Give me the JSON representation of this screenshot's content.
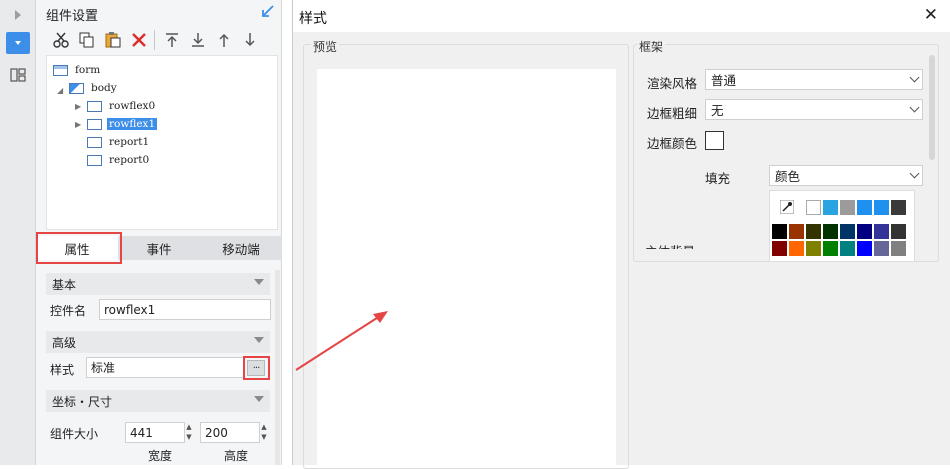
{
  "left_panel": {
    "title": "组件设置",
    "tree": {
      "root": "form",
      "body": "body",
      "items": [
        "rowflex0",
        "rowflex1",
        "report1",
        "report0"
      ]
    },
    "tabs": [
      "属性",
      "事件",
      "移动端"
    ],
    "sections": {
      "basic": "基本",
      "advanced": "高级",
      "position_size": "坐标・尺寸"
    },
    "props": {
      "control_name_label": "控件名",
      "control_name_value": "rowflex1",
      "style_label": "样式",
      "style_value": "标准",
      "ellipsis": "···",
      "size_label": "组件大小",
      "width_value": "441",
      "height_value": "200",
      "width_label": "宽度",
      "height_label": "高度"
    }
  },
  "dialog": {
    "title": "样式",
    "close": "✕",
    "preview_label": "预览",
    "frame_label": "框架",
    "render_style_label": "渲染风格",
    "render_style_value": "普通",
    "border_width_label": "边框粗细",
    "border_width_value": "无",
    "border_color_label": "边框颜色",
    "fill_label": "填充",
    "fill_value": "颜色",
    "cut_text": "主体背景"
  },
  "colors": {
    "highlight_red": "#e64545",
    "selection_blue": "#3d8ee8",
    "palette_row1": [
      "#ffffff",
      "#29a4e0",
      "#9b9b9b",
      "#1e90f0",
      "#1e90f0",
      "#3a3a3a"
    ],
    "palette_row2": [
      "#000000",
      "#993300",
      "#333300",
      "#003300",
      "#003366",
      "#000080",
      "#333399",
      "#333333"
    ],
    "palette_row3": [
      "#800000",
      "#ff6600",
      "#808000",
      "#008000",
      "#008080",
      "#0000ff",
      "#666699",
      "#808080"
    ]
  }
}
